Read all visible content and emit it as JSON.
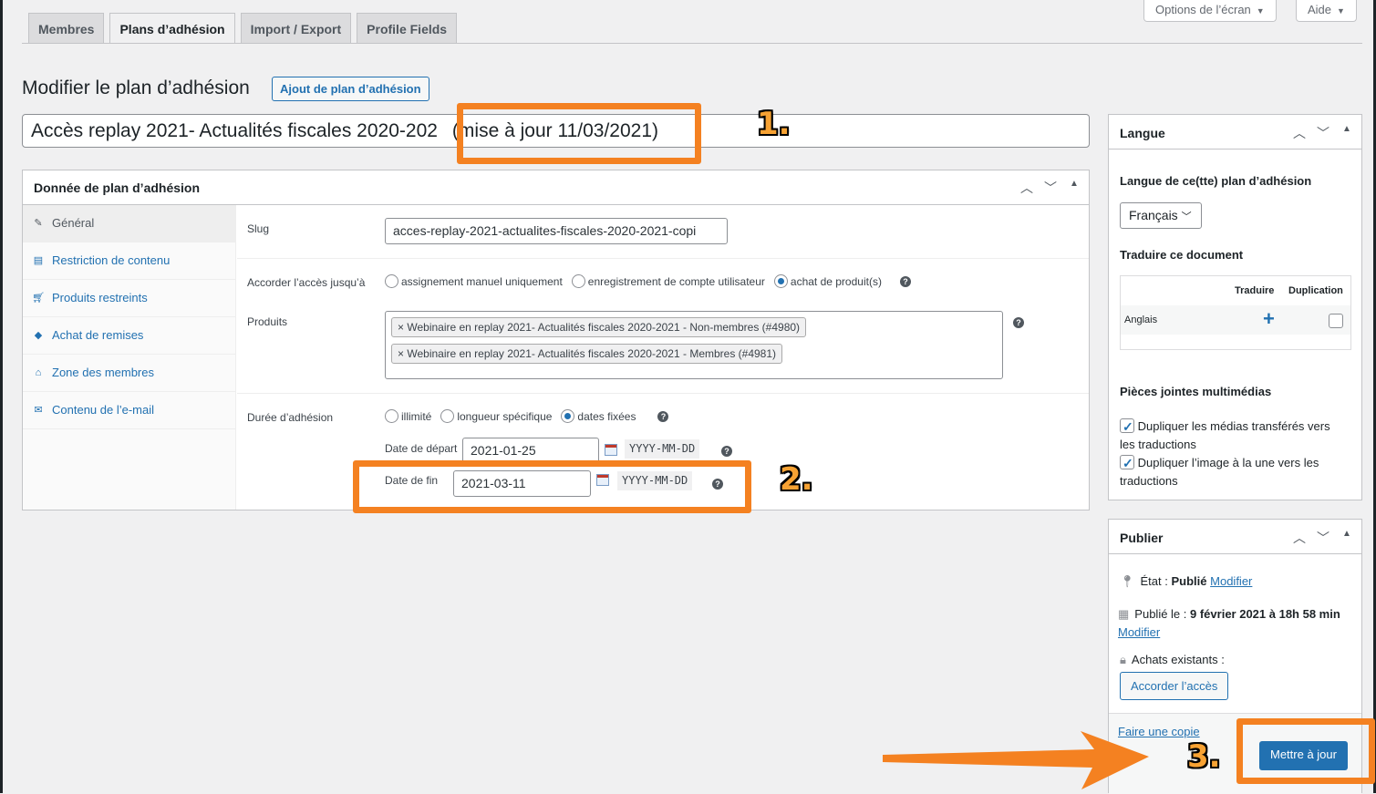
{
  "top_buttons": {
    "screen_options": "Options de l’écran",
    "help": "Aide"
  },
  "tabs": [
    {
      "label": "Membres"
    },
    {
      "label": "Plans d’adhésion",
      "active": true
    },
    {
      "label": "Import / Export"
    },
    {
      "label": "Profile Fields"
    }
  ],
  "header": {
    "title": "Modifier le plan d’adhésion",
    "add_button": "Ajout de plan d’adhésion"
  },
  "plan_title": {
    "part1": "Accès replay 2021- Actualités fiscales 2020-202",
    "part2": "(mise à jour 11/03/2021)"
  },
  "annotations": {
    "n1": "1.",
    "n2": "2.",
    "n3": "3.",
    "color": "#f48121"
  },
  "metabox": {
    "title": "Donnée de plan d’adhésion",
    "side_tabs": [
      {
        "label": "Général",
        "icon": "wrench-icon",
        "active": true
      },
      {
        "label": "Restriction de contenu",
        "icon": "document-icon"
      },
      {
        "label": "Produits restreints",
        "icon": "cart-icon"
      },
      {
        "label": "Achat de remises",
        "icon": "tag-icon"
      },
      {
        "label": "Zone des membres",
        "icon": "home-icon"
      },
      {
        "label": "Contenu de l’e-mail",
        "icon": "email-icon"
      }
    ],
    "slug_label": "Slug",
    "slug_value": "acces-replay-2021-actualites-fiscales-2020-2021-copi",
    "access_label": "Accorder l’accès jusqu’à",
    "access_options": [
      "assignement manuel uniquement",
      "enregistrement de compte utilisateur",
      "achat de produit(s)"
    ],
    "access_selected": 2,
    "products_label": "Produits",
    "products": [
      "Webinaire en replay 2021- Actualités fiscales 2020-2021 - Non-membres (#4980)",
      "Webinaire en replay 2021- Actualités fiscales 2020-2021 - Membres (#4981)"
    ],
    "duration_label": "Durée d’adhésion",
    "duration_options": [
      "illimité",
      "longueur spécifique",
      "dates fixées"
    ],
    "duration_selected": 2,
    "start_label": "Date de départ",
    "start_value": "2021-01-25",
    "end_label": "Date de fin",
    "end_value": "2021-03-11",
    "date_format": "YYYY-MM-DD",
    "help_glyph": "?",
    "remove_glyph": "×"
  },
  "language_box": {
    "title": "Langue",
    "lang_label": "Langue de ce(tte) plan d’adhésion",
    "lang_value": "Français",
    "translate_heading": "Traduire ce document",
    "col_translate": "Traduire",
    "col_duplicate": "Duplication",
    "row_language": "Anglais",
    "add_glyph": "+",
    "media_heading": "Pièces jointes multimédias",
    "media_opt1": "Dupliquer les médias transférés vers les traductions",
    "media_opt2": "Dupliquer l’image à la une vers les traductions"
  },
  "publish_box": {
    "title": "Publier",
    "status_label": "État :",
    "status_value": "Publié",
    "status_link": "Modifier",
    "published_label": "Publié le :",
    "published_value": "9 février 2021 à 18h 58 min",
    "published_link": "Modifier",
    "purchases_label": "Achats existants :",
    "grant_button": "Accorder l’accès",
    "copy_link": "Faire une copie",
    "update_button": "Mettre à jour"
  }
}
